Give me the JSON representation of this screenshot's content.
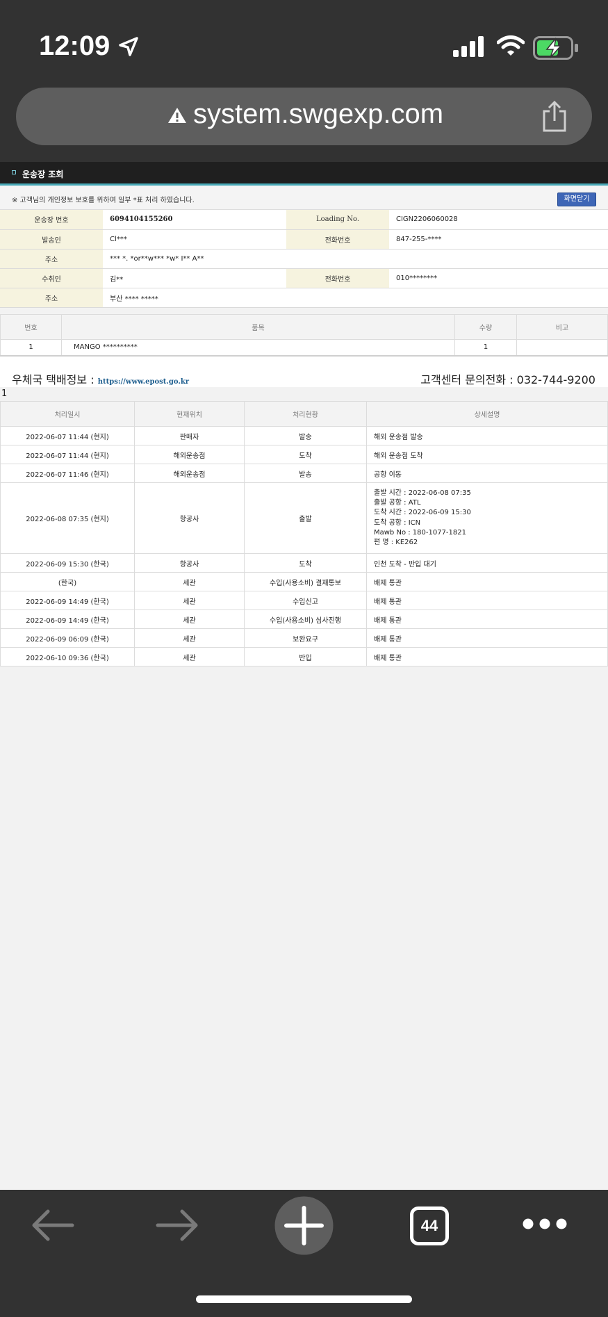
{
  "status_bar": {
    "time": "12:09"
  },
  "browser": {
    "url": "system.swgexp.com",
    "tab_count": "44"
  },
  "page": {
    "title": "운송장 조회",
    "notice": "※ 고객님의 개인정보 보호를 위하여 일부 *표 처리 하였습니다.",
    "close_button": "화면닫기"
  },
  "info": {
    "tracking_label": "운송장 번호",
    "tracking_value": "6094104155260",
    "loading_label": "Loading No.",
    "loading_value": "CIGN2206060028",
    "sender_label": "발송인",
    "sender_value": "Cl***",
    "sender_phone_label": "전화번호",
    "sender_phone_value": "847-255-****",
    "sender_addr_label": "주소",
    "sender_addr_value": "*** *. *or**w*** *w* I** A**",
    "receiver_label": "수취인",
    "receiver_value": "김**",
    "receiver_phone_label": "전화번호",
    "receiver_phone_value": "010********",
    "receiver_addr_label": "주소",
    "receiver_addr_value": "부산 **** *****"
  },
  "items": {
    "headers": [
      "번호",
      "품목",
      "수량",
      "비고"
    ],
    "rows": [
      {
        "no": "1",
        "name": "MANGO **********",
        "qty": "1",
        "note": ""
      }
    ]
  },
  "epost": {
    "label": "우체국 택배정보 :",
    "link": "https://www.epost.go.kr",
    "contact": "고객센터 문의전화 : 032-744-9200",
    "count": "1"
  },
  "tracking": {
    "headers": [
      "처리일시",
      "현재위치",
      "처리현황",
      "상세설명"
    ],
    "rows": [
      {
        "time": "2022-06-07 11:44 (현지)",
        "location": "판매자",
        "status": "발송",
        "desc": "해외 운송점 발송"
      },
      {
        "time": "2022-06-07 11:44 (현지)",
        "location": "해외운송점",
        "status": "도착",
        "desc": "해외 운송점 도착"
      },
      {
        "time": "2022-06-07 11:46 (현지)",
        "location": "해외운송점",
        "status": "발송",
        "desc": "공항 이동"
      },
      {
        "time": "2022-06-08 07:35 (현지)",
        "location": "항공사",
        "status": "출발",
        "desc_lines": [
          "출발 시간 : 2022-06-08 07:35",
          "출발 공항 : ATL",
          "도착 시간 : 2022-06-09 15:30",
          "도착 공항 : ICN",
          "Mawb No : 180-1077-1821",
          "편      명 : KE262"
        ]
      },
      {
        "time": "2022-06-09 15:30 (한국)",
        "location": "항공사",
        "status": "도착",
        "desc": "인천 도착 - 반입 대기"
      },
      {
        "time": "(한국)",
        "location": "세관",
        "status": "수입(사용소비) 결재통보",
        "desc": "배제 통관"
      },
      {
        "time": "2022-06-09 14:49 (한국)",
        "location": "세관",
        "status": "수입신고",
        "desc": "배제 통관"
      },
      {
        "time": "2022-06-09 14:49 (한국)",
        "location": "세관",
        "status": "수입(사용소비) 심사진행",
        "desc": "배제 통관"
      },
      {
        "time": "2022-06-09 06:09 (한국)",
        "location": "세관",
        "status": "보완요구",
        "desc": "배제 통관"
      },
      {
        "time": "2022-06-10 09:36 (한국)",
        "location": "세관",
        "status": "반입",
        "desc": "배제 통관"
      }
    ]
  }
}
